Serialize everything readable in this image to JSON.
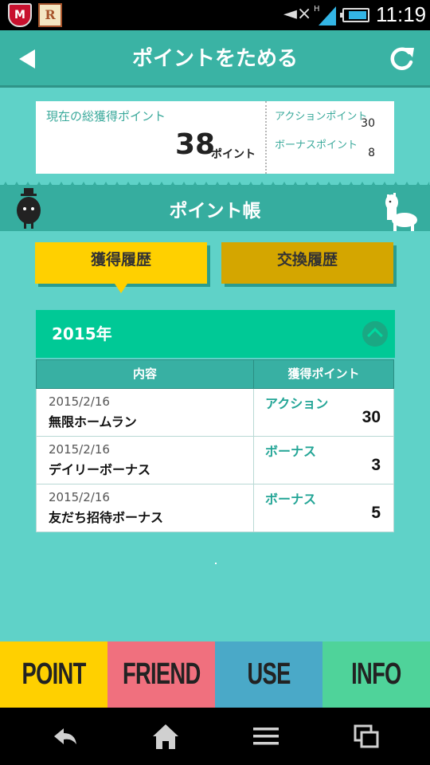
{
  "status_bar": {
    "time": "11:19",
    "icons": [
      "mcafee-icon",
      "r-app-icon",
      "mute-icon",
      "signal-icon",
      "battery-icon"
    ],
    "network_label": "H"
  },
  "header": {
    "title": "ポイントをためる",
    "back_icon": "back-arrow-icon",
    "refresh_icon": "refresh-icon"
  },
  "summary": {
    "total_label": "現在の総獲得ポイント",
    "total_value": "38",
    "total_unit": "ポイント",
    "action_label": "アクションポイント",
    "action_value": "30",
    "bonus_label": "ボーナスポイント",
    "bonus_value": "8"
  },
  "banner": {
    "title": "ポイント帳"
  },
  "tabs": {
    "earned": "獲得履歴",
    "exchange": "交換履歴",
    "active": "earned"
  },
  "history": {
    "year": "2015年",
    "columns": {
      "content": "内容",
      "points": "獲得ポイント"
    },
    "rows": [
      {
        "date": "2015/2/16",
        "title": "無限ホームラン",
        "type": "アクション",
        "points": "30"
      },
      {
        "date": "2015/2/16",
        "title": "デイリーボーナス",
        "type": "ボーナス",
        "points": "3"
      },
      {
        "date": "2015/2/16",
        "title": "友だち招待ボーナス",
        "type": "ボーナス",
        "points": "5"
      }
    ]
  },
  "bottom_nav": {
    "point": "POINT",
    "friend": "FRIEND",
    "use": "USE",
    "info": "INFO"
  },
  "colors": {
    "background": "#5fd2c8",
    "header": "#3ab3a4",
    "accent_yellow": "#ffd000",
    "accent_green": "#00c996",
    "nav_point": "#ffd000",
    "nav_friend": "#f0707e",
    "nav_use": "#4aa9c8",
    "nav_info": "#4fd39a"
  }
}
